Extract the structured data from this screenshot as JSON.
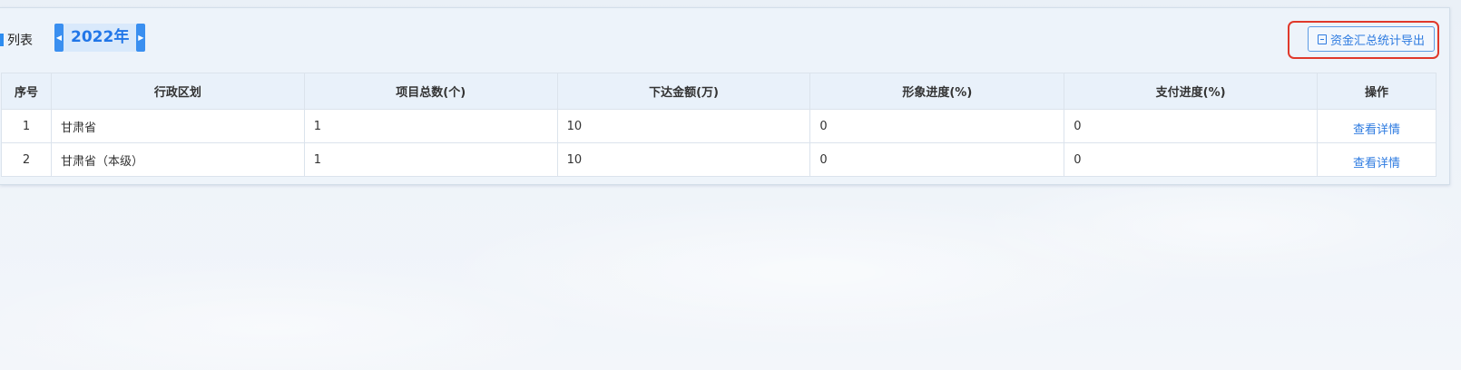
{
  "header": {
    "list_label": "列表",
    "year": "2022年",
    "export_button": "资金汇总统计导出"
  },
  "table": {
    "columns": [
      "序号",
      "行政区划",
      "项目总数(个)",
      "下达金额(万)",
      "形象进度(%)",
      "支付进度(%)",
      "操作"
    ],
    "rows": [
      {
        "index": "1",
        "region": "甘肃省",
        "projects": "1",
        "amount": "10",
        "image_progress": "0",
        "pay_progress": "0",
        "action": "查看详情"
      },
      {
        "index": "2",
        "region": "甘肃省（本级）",
        "projects": "1",
        "amount": "10",
        "image_progress": "0",
        "pay_progress": "0",
        "action": "查看详情"
      }
    ]
  },
  "colors": {
    "accent": "#2e7be0",
    "highlight_border": "#e0392b"
  }
}
